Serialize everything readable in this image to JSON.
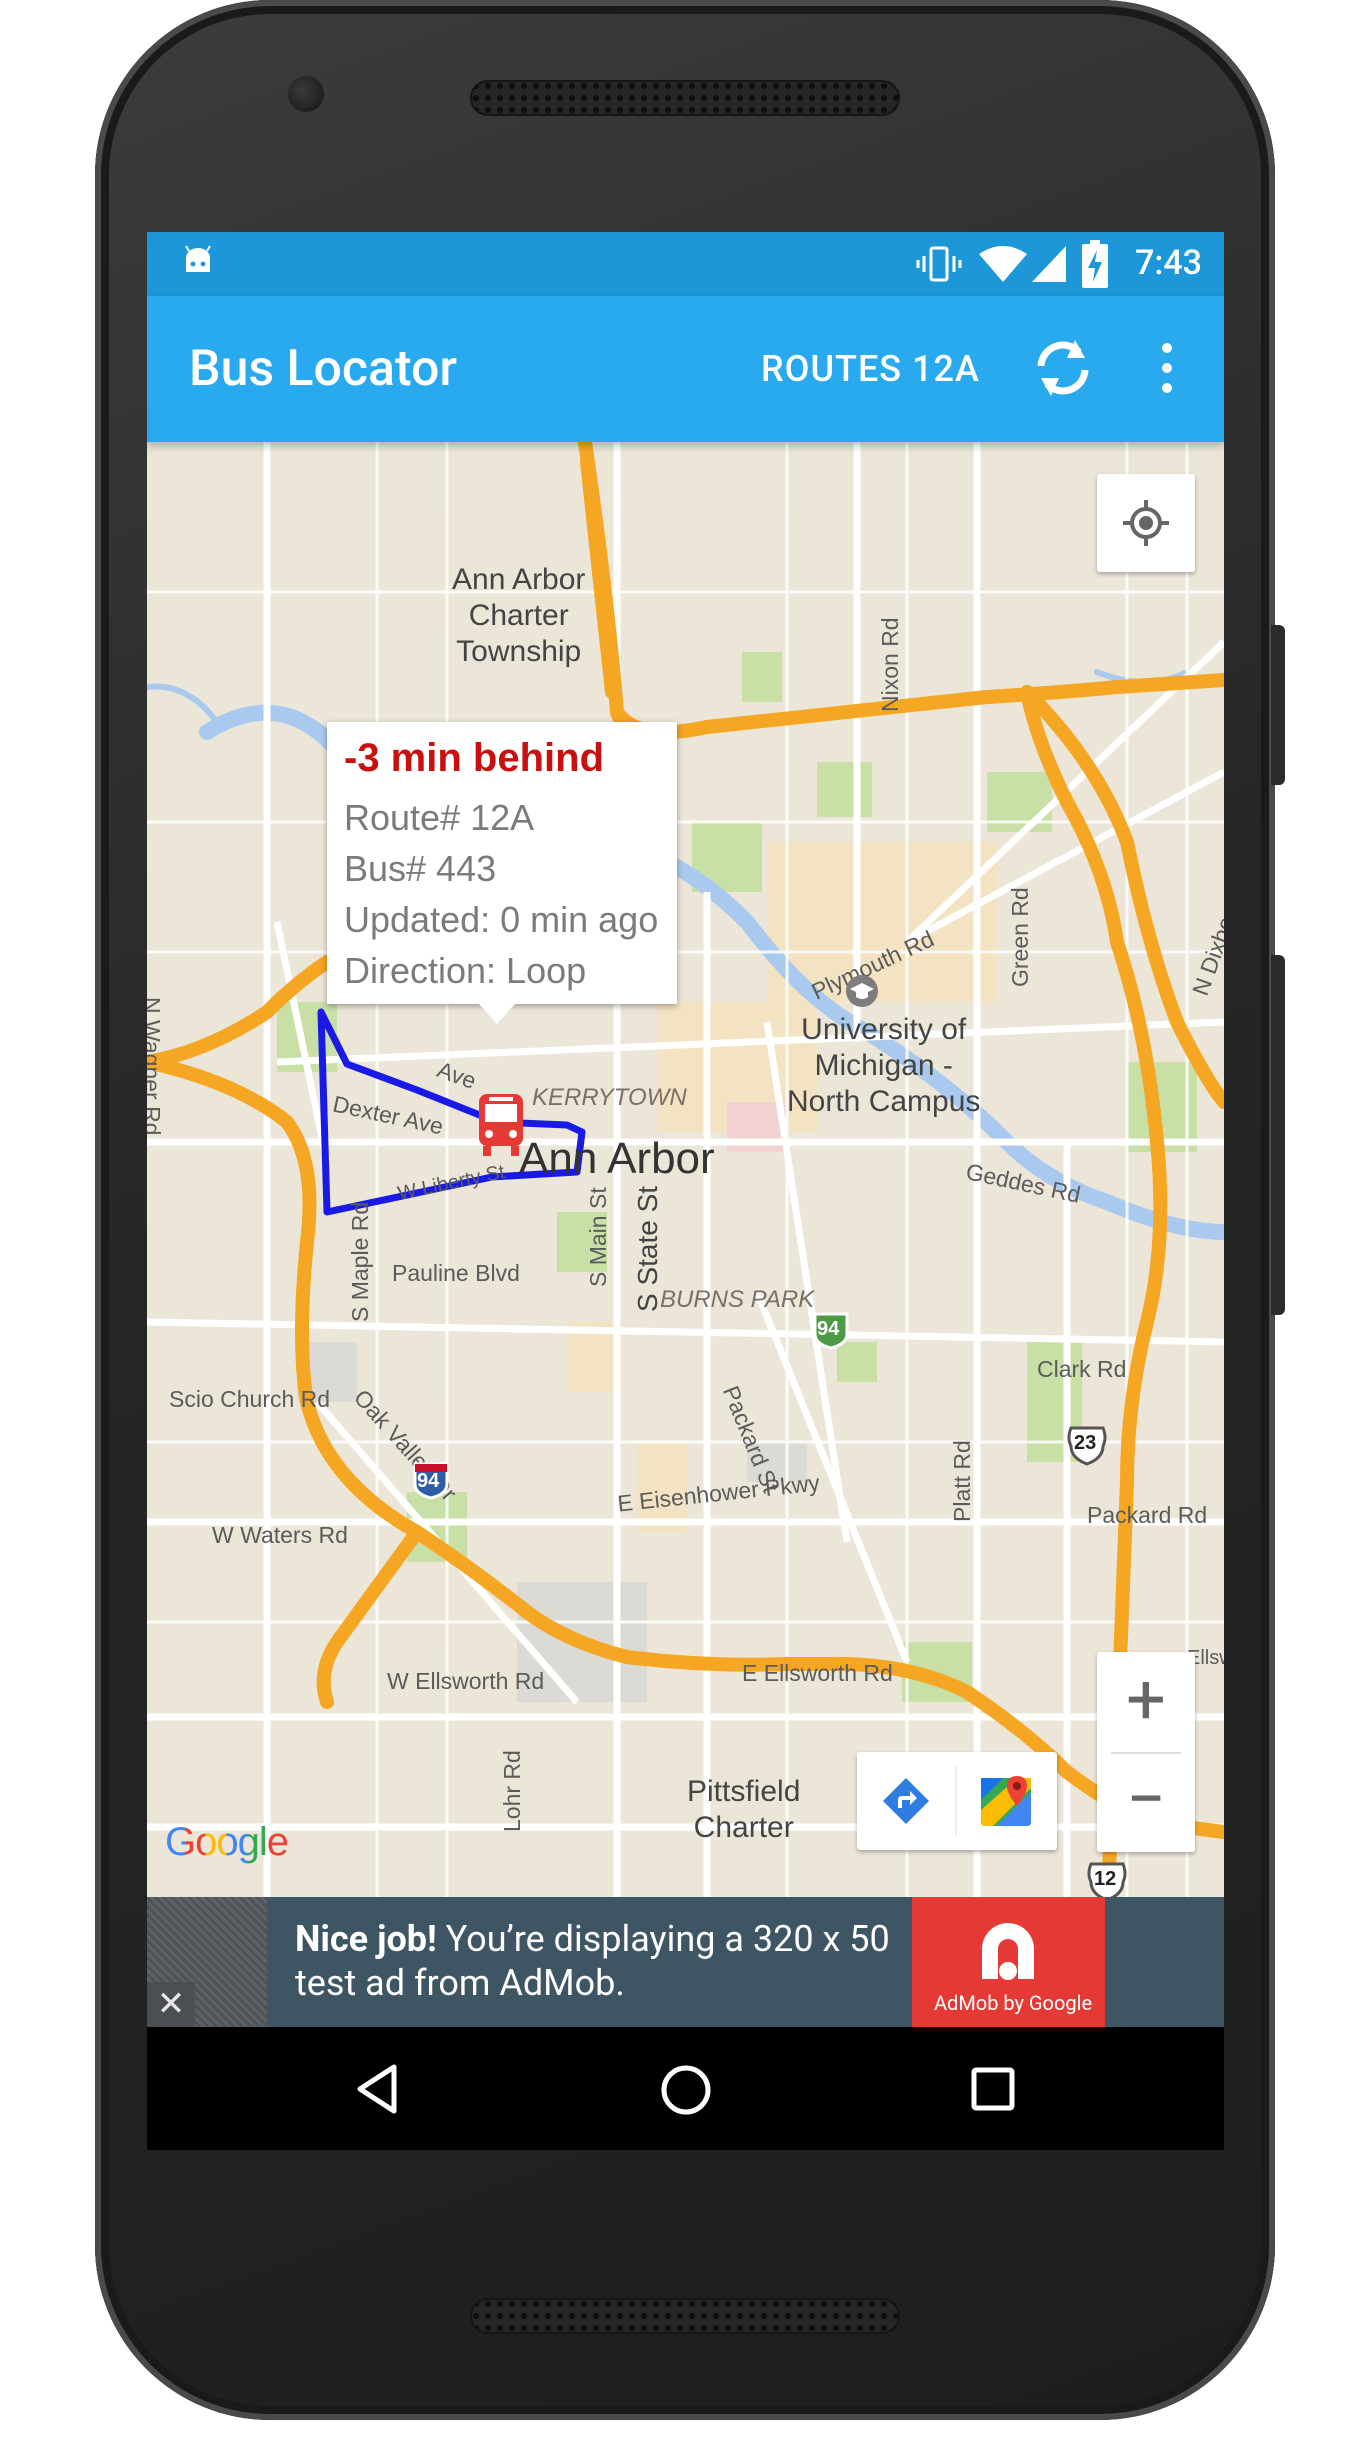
{
  "status_bar": {
    "time": "7:43",
    "icons": [
      "android-icon",
      "vibrate-icon",
      "wifi-icon",
      "signal-icon",
      "battery-charging-icon"
    ]
  },
  "app_bar": {
    "title": "Bus Locator",
    "routes_label": "ROUTES 12A",
    "refresh_icon": "refresh-icon",
    "overflow_icon": "overflow-menu-icon"
  },
  "info_window": {
    "status": "-3 min behind",
    "route": "Route# 12A",
    "bus": "Bus# 443",
    "updated": "Updated: 0 min ago",
    "direction": "Direction: Loop",
    "status_color": "#C81010"
  },
  "map": {
    "places": {
      "township": "Ann Arbor\nCharter\nTownship",
      "university": "University of\nMichigan -\nNorth Campus",
      "city": "Ann Arbor",
      "kerrytown": "KERRYTOWN",
      "burns_park": "BURNS PARK",
      "pittsfield": "Pittsfield\nCharter"
    },
    "roads": {
      "nixon": "Nixon Rd",
      "plymouth": "Plymouth Rd",
      "green": "Green Rd",
      "dixboro": "N Dixboro Rd",
      "wagner": "N Wagner Rd",
      "dexter": "Dexter Ave",
      "huron": "Ave",
      "liberty": "W Liberty St",
      "maple": "S Maple Rd",
      "pauline": "Pauline Blvd",
      "main": "S Main St",
      "state": "S State St",
      "packard_st": "Packard St",
      "geddes": "Geddes Rd",
      "clark": "Clark Rd",
      "scio": "Scio Church Rd",
      "oak_valley": "Oak Valley Dr",
      "eisenhower": "E Eisenhower Pkwy",
      "platt": "Platt Rd",
      "packard_rd": "Packard Rd",
      "waters": "W Waters Rd",
      "w_ellsworth": "W Ellsworth Rd",
      "e_ellsworth": "E Ellsworth Rd",
      "ellsworth_edge": "Ellswo",
      "lohr": "Lohr Rd"
    },
    "shields": {
      "i94_a": "94",
      "i94_b": "94",
      "us23": "23",
      "us12": "12"
    },
    "route_color": "#1A1AE6",
    "highway_color": "#F5A623",
    "bus_marker_color": "#E53935",
    "zoom_in": "+",
    "zoom_out": "−",
    "my_location_icon": "my-location-icon",
    "directions_icon": "directions-icon",
    "maps_icon": "google-maps-icon",
    "attribution": "Google"
  },
  "ad": {
    "headline": "Nice job!",
    "body": "You’re displaying a 320 x 50 test ad from AdMob.",
    "brand": "AdMob by Google",
    "close": "✕"
  },
  "nav_bar": {
    "icons": [
      "back-icon",
      "home-icon",
      "recents-icon"
    ]
  }
}
